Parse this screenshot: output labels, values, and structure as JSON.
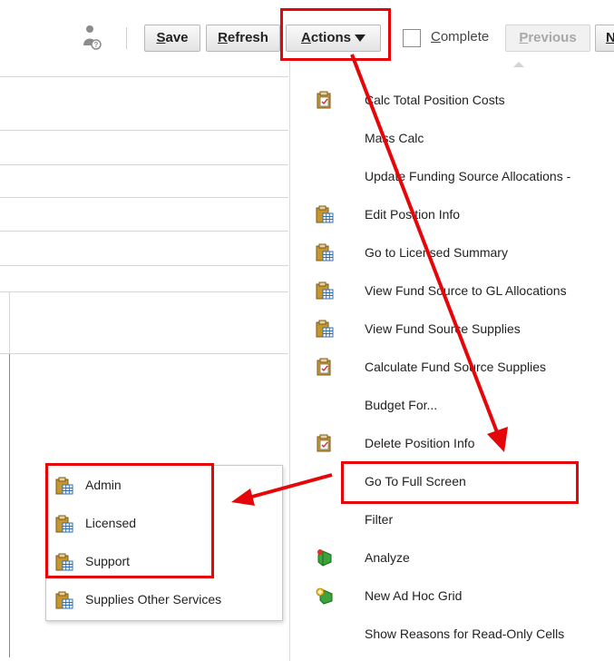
{
  "toolbar": {
    "save_label": "Save",
    "save_key": "S",
    "refresh_label": "Refresh",
    "refresh_key": "R",
    "actions_label": "Actions",
    "actions_key": "A",
    "complete_label": "Complete",
    "complete_key": "C",
    "complete_checked": false,
    "previous_label": "Previous",
    "previous_key": "P",
    "previous_enabled": false,
    "next_label": "N"
  },
  "actions_menu": {
    "items": [
      {
        "label": "Calc Total Position Costs",
        "icon": "calc-rule-icon"
      },
      {
        "label": "Mass Calc",
        "icon": ""
      },
      {
        "label": "Update Funding Source Allocations -",
        "icon": ""
      },
      {
        "label": "Edit Position Info",
        "icon": "form-icon"
      },
      {
        "label": "Go to Licensed Summary",
        "icon": "form-icon"
      },
      {
        "label": "View Fund Source to GL Allocations",
        "icon": "form-icon"
      },
      {
        "label": "View Fund Source Supplies",
        "icon": "form-icon"
      },
      {
        "label": "Calculate Fund Source Supplies",
        "icon": "calc-rule-icon"
      },
      {
        "label": "Budget For...",
        "icon": ""
      },
      {
        "label": "Delete Position Info",
        "icon": "calc-rule-icon"
      },
      {
        "label": "Go To Full Screen",
        "icon": ""
      },
      {
        "label": "Filter",
        "icon": ""
      },
      {
        "label": "Analyze",
        "icon": "analyze-icon"
      },
      {
        "label": "New Ad Hoc Grid",
        "icon": "ad-hoc-grid-icon"
      },
      {
        "label": "Show Reasons for Read-Only Cells",
        "icon": ""
      }
    ]
  },
  "submenu": {
    "items": [
      {
        "label": "Admin",
        "icon": "form-icon"
      },
      {
        "label": "Licensed",
        "icon": "form-icon"
      },
      {
        "label": "Support",
        "icon": "form-icon"
      },
      {
        "label": "Supplies Other Services",
        "icon": "form-icon"
      }
    ]
  },
  "colors": {
    "annotation_red": "#e5060a",
    "clipboard_tan": "#c8962e",
    "grid_blue": "#2f6fb5"
  }
}
